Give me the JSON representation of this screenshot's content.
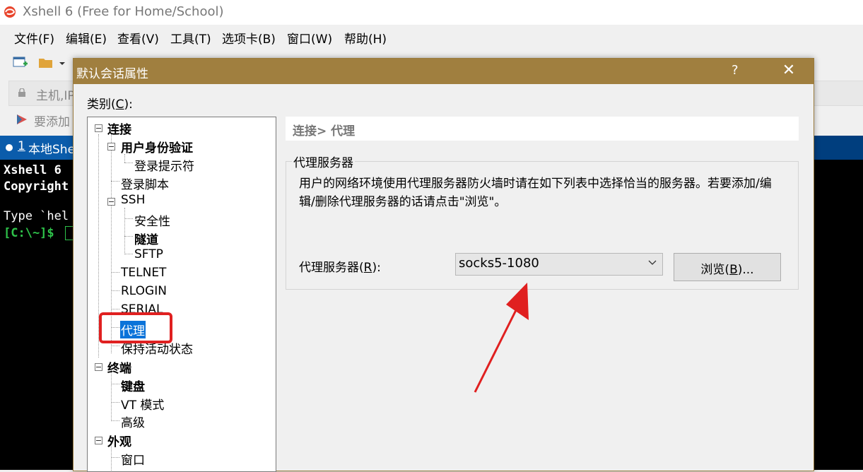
{
  "app": {
    "title": "Xshell 6 (Free for Home/School)",
    "menu": [
      "文件(F)",
      "编辑(E)",
      "查看(V)",
      "工具(T)",
      "选项卡(B)",
      "窗口(W)",
      "帮助(H)"
    ],
    "address_placeholder": "主机,IP",
    "links_text": "要添加",
    "tab": {
      "number": "1",
      "label": "本地She"
    },
    "terminal_lines": [
      "Xshell 6",
      "Copyright",
      "",
      "Type `hel",
      "[C:\\~]$ "
    ]
  },
  "dialog": {
    "title": "默认会话属性",
    "help_label": "?",
    "close_label": "✕",
    "category_label": "类别(",
    "category_hotkey": "C",
    "category_suffix": "):",
    "tree": [
      {
        "label": "连接"
      },
      {
        "label": "用户身份验证"
      },
      {
        "label": "登录提示符"
      },
      {
        "label": "登录脚本"
      },
      {
        "label": "SSH"
      },
      {
        "label": "安全性"
      },
      {
        "label": "隧道"
      },
      {
        "label": "SFTP"
      },
      {
        "label": "TELNET"
      },
      {
        "label": "RLOGIN"
      },
      {
        "label": "SERIAL"
      },
      {
        "label": "代理"
      },
      {
        "label": "保持活动状态"
      },
      {
        "label": "终端"
      },
      {
        "label": "键盘"
      },
      {
        "label": "VT 模式"
      },
      {
        "label": "高级"
      },
      {
        "label": "外观"
      },
      {
        "label": "窗口"
      }
    ],
    "selected_item": "代理",
    "breadcrumb": "连接> 代理",
    "group_title": "代理服务器",
    "description": "用户的网络环境使用代理服务器防火墙时请在如下列表中选择恰当的服务器。若要添加/编辑/删除代理服务器的话请点击\"浏览\"。",
    "proxy_label": "代理服务器(",
    "proxy_hotkey": "R",
    "proxy_suffix": "):",
    "proxy_value": "socks5-1080",
    "browse_label": "浏览(",
    "browse_hotkey": "B",
    "browse_suffix": ")..."
  },
  "colors": {
    "dialog_titlebar": "#a07f3f",
    "tab_bar": "#003e7e",
    "selection": "#0b73d9",
    "annotation_red": "#e02020"
  }
}
